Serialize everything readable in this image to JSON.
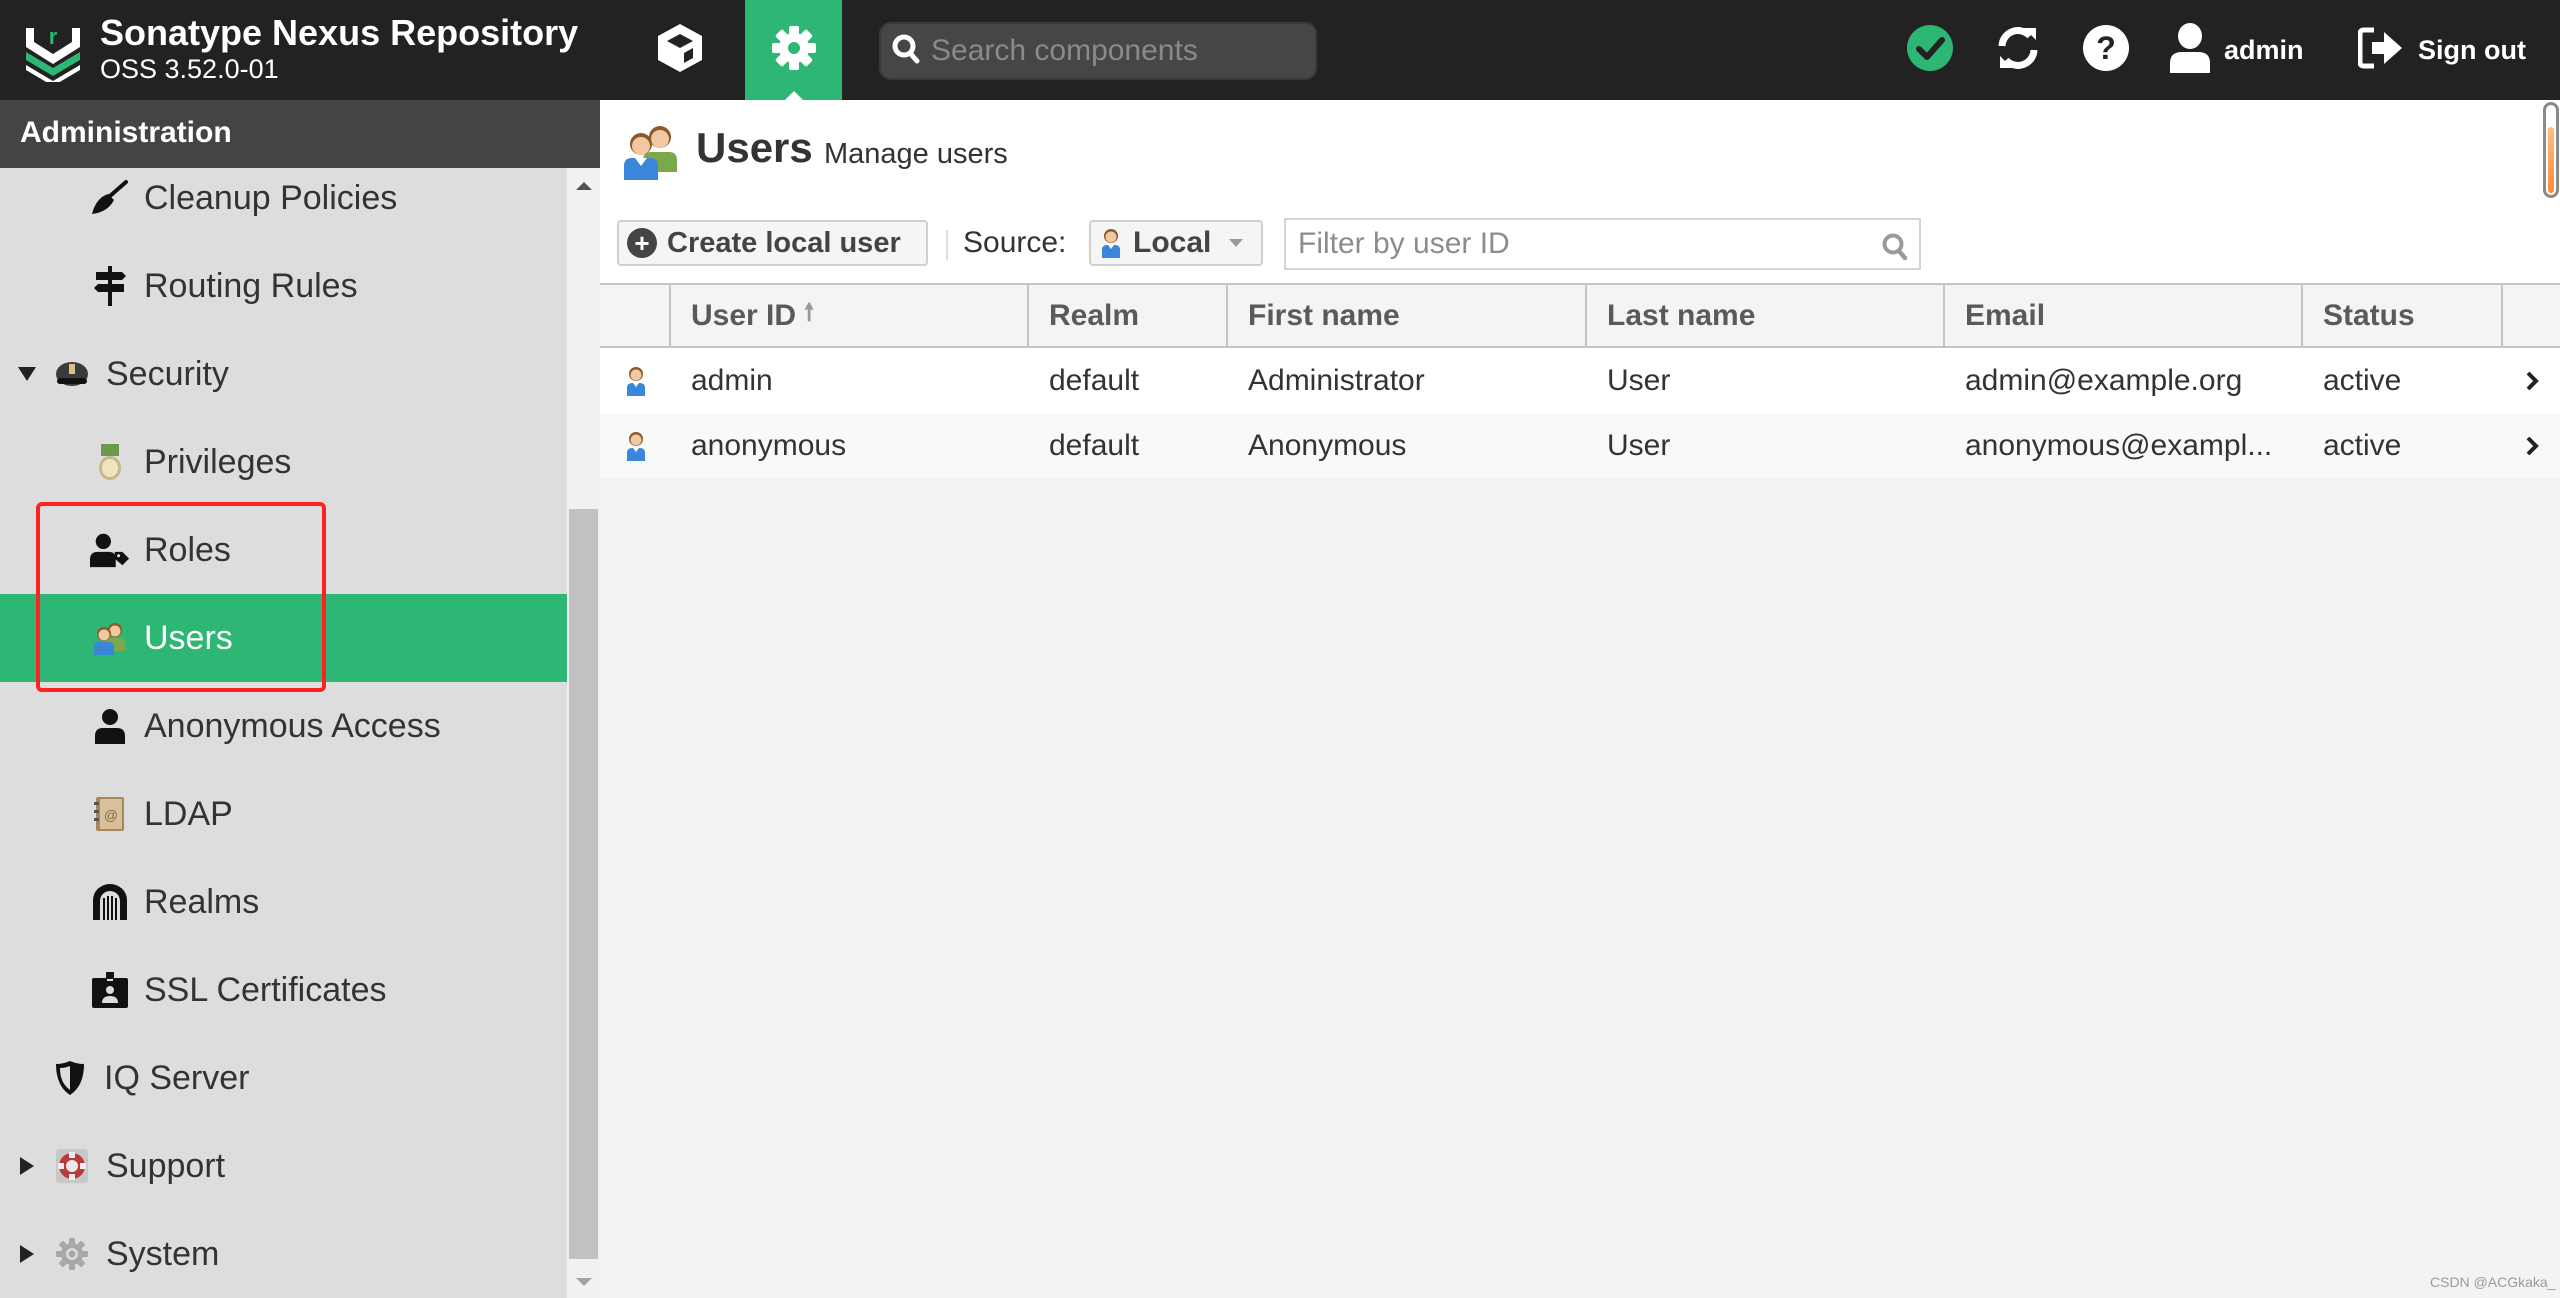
{
  "header": {
    "brand_title": "Sonatype Nexus Repository",
    "brand_version": "OSS 3.52.0-01",
    "nav_buttons": [
      {
        "name": "browse",
        "icon": "cube-icon",
        "active": false
      },
      {
        "name": "administration",
        "icon": "gear-icon",
        "active": true
      }
    ],
    "search_placeholder": "Search components",
    "search_value": "",
    "status_icon": "check-circle-icon",
    "refresh_icon": "refresh-icon",
    "help_icon": "help-icon",
    "user_label": "admin",
    "signout_label": "Sign out"
  },
  "sidebar": {
    "title": "Administration",
    "items": [
      {
        "label": "Cleanup Policies",
        "icon": "broom-icon",
        "level": 2
      },
      {
        "label": "Routing Rules",
        "icon": "signpost-icon",
        "level": 2
      },
      {
        "label": "Security",
        "icon": "police-cap-icon",
        "level": 1,
        "expanded": true
      },
      {
        "label": "Privileges",
        "icon": "medal-icon",
        "level": 2
      },
      {
        "label": "Roles",
        "icon": "user-tag-icon",
        "level": 2
      },
      {
        "label": "Users",
        "icon": "users-icon",
        "level": 2,
        "active": true
      },
      {
        "label": "Anonymous Access",
        "icon": "user-icon",
        "level": 2
      },
      {
        "label": "LDAP",
        "icon": "address-book-icon",
        "level": 2
      },
      {
        "label": "Realms",
        "icon": "gate-icon",
        "level": 2
      },
      {
        "label": "SSL Certificates",
        "icon": "id-badge-icon",
        "level": 2
      },
      {
        "label": "IQ Server",
        "icon": "shield-icon",
        "level": 1
      },
      {
        "label": "Support",
        "icon": "lifebuoy-icon",
        "level": 1,
        "expanded": false
      },
      {
        "label": "System",
        "icon": "cog-icon",
        "level": 1,
        "expanded": false
      }
    ]
  },
  "page": {
    "title": "Users",
    "subtitle": "Manage users",
    "icon": "users-icon"
  },
  "toolbar": {
    "create_label": "Create local user",
    "source_label": "Source:",
    "source_value": "Local",
    "filter_placeholder": "Filter by user ID",
    "filter_value": ""
  },
  "grid": {
    "columns": [
      "",
      "User ID",
      "Realm",
      "First name",
      "Last name",
      "Email",
      "Status",
      ""
    ],
    "sort_column": "User ID",
    "sort_direction": "ascending",
    "rows": [
      {
        "user_id": "admin",
        "realm": "default",
        "first_name": "Administrator",
        "last_name": "User",
        "email": "admin@example.org",
        "status": "active"
      },
      {
        "user_id": "anonymous",
        "realm": "default",
        "first_name": "Anonymous",
        "last_name": "User",
        "email": "anonymous@exampl...",
        "status": "active"
      }
    ]
  },
  "annotation": {
    "highlight": "red-box around Roles and Users"
  },
  "watermark": "CSDN @ACGkaka_",
  "colors": {
    "accent_green": "#2db674",
    "topbar": "#222222",
    "adminbar": "#444444",
    "sidebar": "#dddddd",
    "highlight_red": "#ff2222"
  }
}
